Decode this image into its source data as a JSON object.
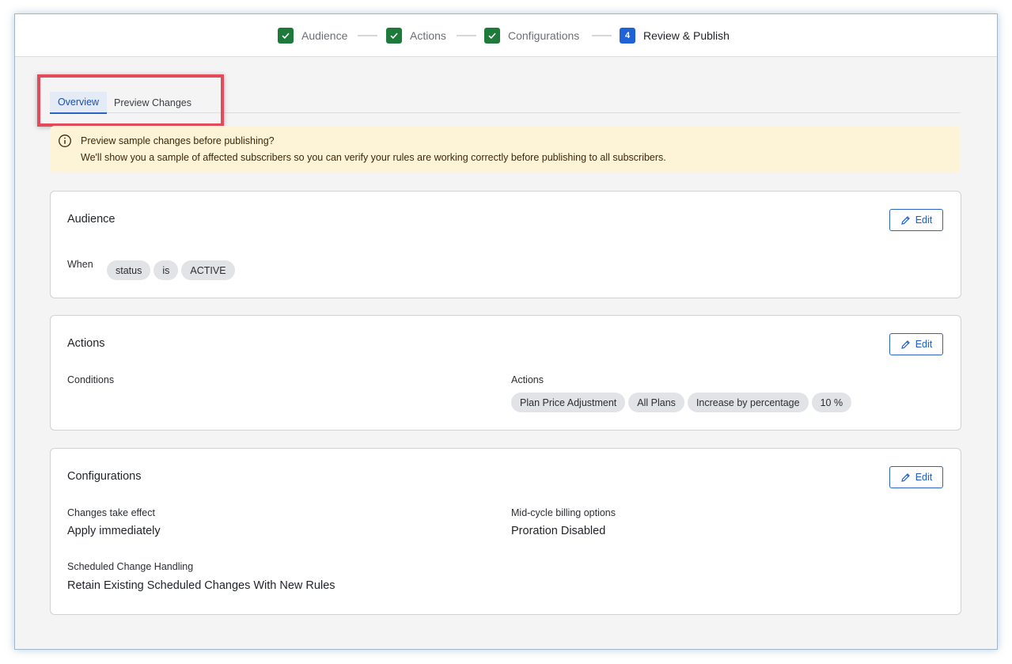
{
  "stepper": {
    "steps": [
      {
        "label": "Audience",
        "state": "complete"
      },
      {
        "label": "Actions",
        "state": "complete"
      },
      {
        "label": "Configurations",
        "state": "complete"
      },
      {
        "label": "Review & Publish",
        "state": "current",
        "number": "4"
      }
    ]
  },
  "tabs": [
    {
      "label": "Overview",
      "active": true
    },
    {
      "label": "Preview Changes",
      "active": false
    }
  ],
  "banner": {
    "icon": "info-icon",
    "title": "Preview sample changes before publishing?",
    "text": "We'll show you a sample of affected subscribers so you can verify your rules are working correctly before publishing to all subscribers."
  },
  "audience_card": {
    "title": "Audience",
    "edit_label": "Edit",
    "when_label": "When",
    "chips": [
      "status",
      "is",
      "ACTIVE"
    ]
  },
  "actions_card": {
    "title": "Actions",
    "edit_label": "Edit",
    "conditions_label": "Conditions",
    "actions_label": "Actions",
    "chips": [
      "Plan Price Adjustment",
      "All Plans",
      "Increase by percentage",
      "10 %"
    ]
  },
  "configurations_card": {
    "title": "Configurations",
    "edit_label": "Edit",
    "changes_take_effect_label": "Changes take effect",
    "changes_take_effect_value": "Apply immediately",
    "mid_cycle_label": "Mid-cycle billing options",
    "mid_cycle_value": "Proration Disabled",
    "scheduled_label": "Scheduled Change Handling",
    "scheduled_value": "Retain Existing Scheduled Changes With New Rules"
  },
  "colors": {
    "complete": "#1e7a3a",
    "current": "#1f62d6",
    "accent": "#2b63c4",
    "banner_bg": "#fdf3d6",
    "highlight": "#e34a5a"
  }
}
